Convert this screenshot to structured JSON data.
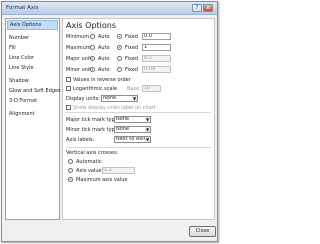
{
  "window": {
    "title": "Format Axis",
    "help_symbol": "?",
    "close_symbol": "x"
  },
  "sidebar": {
    "items": [
      {
        "label": "Axis Options"
      },
      {
        "label": "Number"
      },
      {
        "label": "Fill"
      },
      {
        "label": "Line Color"
      },
      {
        "label": "Line Style"
      },
      {
        "label": "Shadow"
      },
      {
        "label": "Glow and Soft Edges"
      },
      {
        "label": "3-D Format"
      },
      {
        "label": "Alignment"
      }
    ]
  },
  "panel": {
    "heading": "Axis Options",
    "scale_rows": [
      {
        "label": "Minimum:",
        "auto_label": "Auto",
        "fixed_label": "Fixed",
        "value": "0.0"
      },
      {
        "label": "Maximum:",
        "auto_label": "Auto",
        "fixed_label": "Fixed",
        "value": "1"
      },
      {
        "label": "Major unit:",
        "auto_label": "Auto",
        "fixed_label": "Fixed",
        "value": "0.2"
      },
      {
        "label": "Minor unit:",
        "auto_label": "Auto",
        "fixed_label": "Fixed",
        "value": "0.04"
      }
    ],
    "values_reverse_label": "Values in reverse order",
    "log_scale_label": "Logarithmic scale",
    "base_label": "Base:",
    "base_value": "10",
    "display_units_label": "Display units:",
    "display_units_value": "None",
    "show_units_label": "Show display units label on chart",
    "major_tick_label": "Major tick mark type:",
    "major_tick_value": "None",
    "minor_tick_label": "Minor tick mark type:",
    "minor_tick_value": "None",
    "axis_labels_label": "Axis labels:",
    "axis_labels_value": "Next to Axis",
    "crosses_heading": "Vertical axis crosses:",
    "crosses_automatic_label": "Automatic",
    "crosses_value_label": "Axis value:",
    "crosses_value": "1.2",
    "crosses_max_label": "Maximum axis value",
    "dropdown_glyph": "▼"
  },
  "footer": {
    "close_label": "Close"
  }
}
